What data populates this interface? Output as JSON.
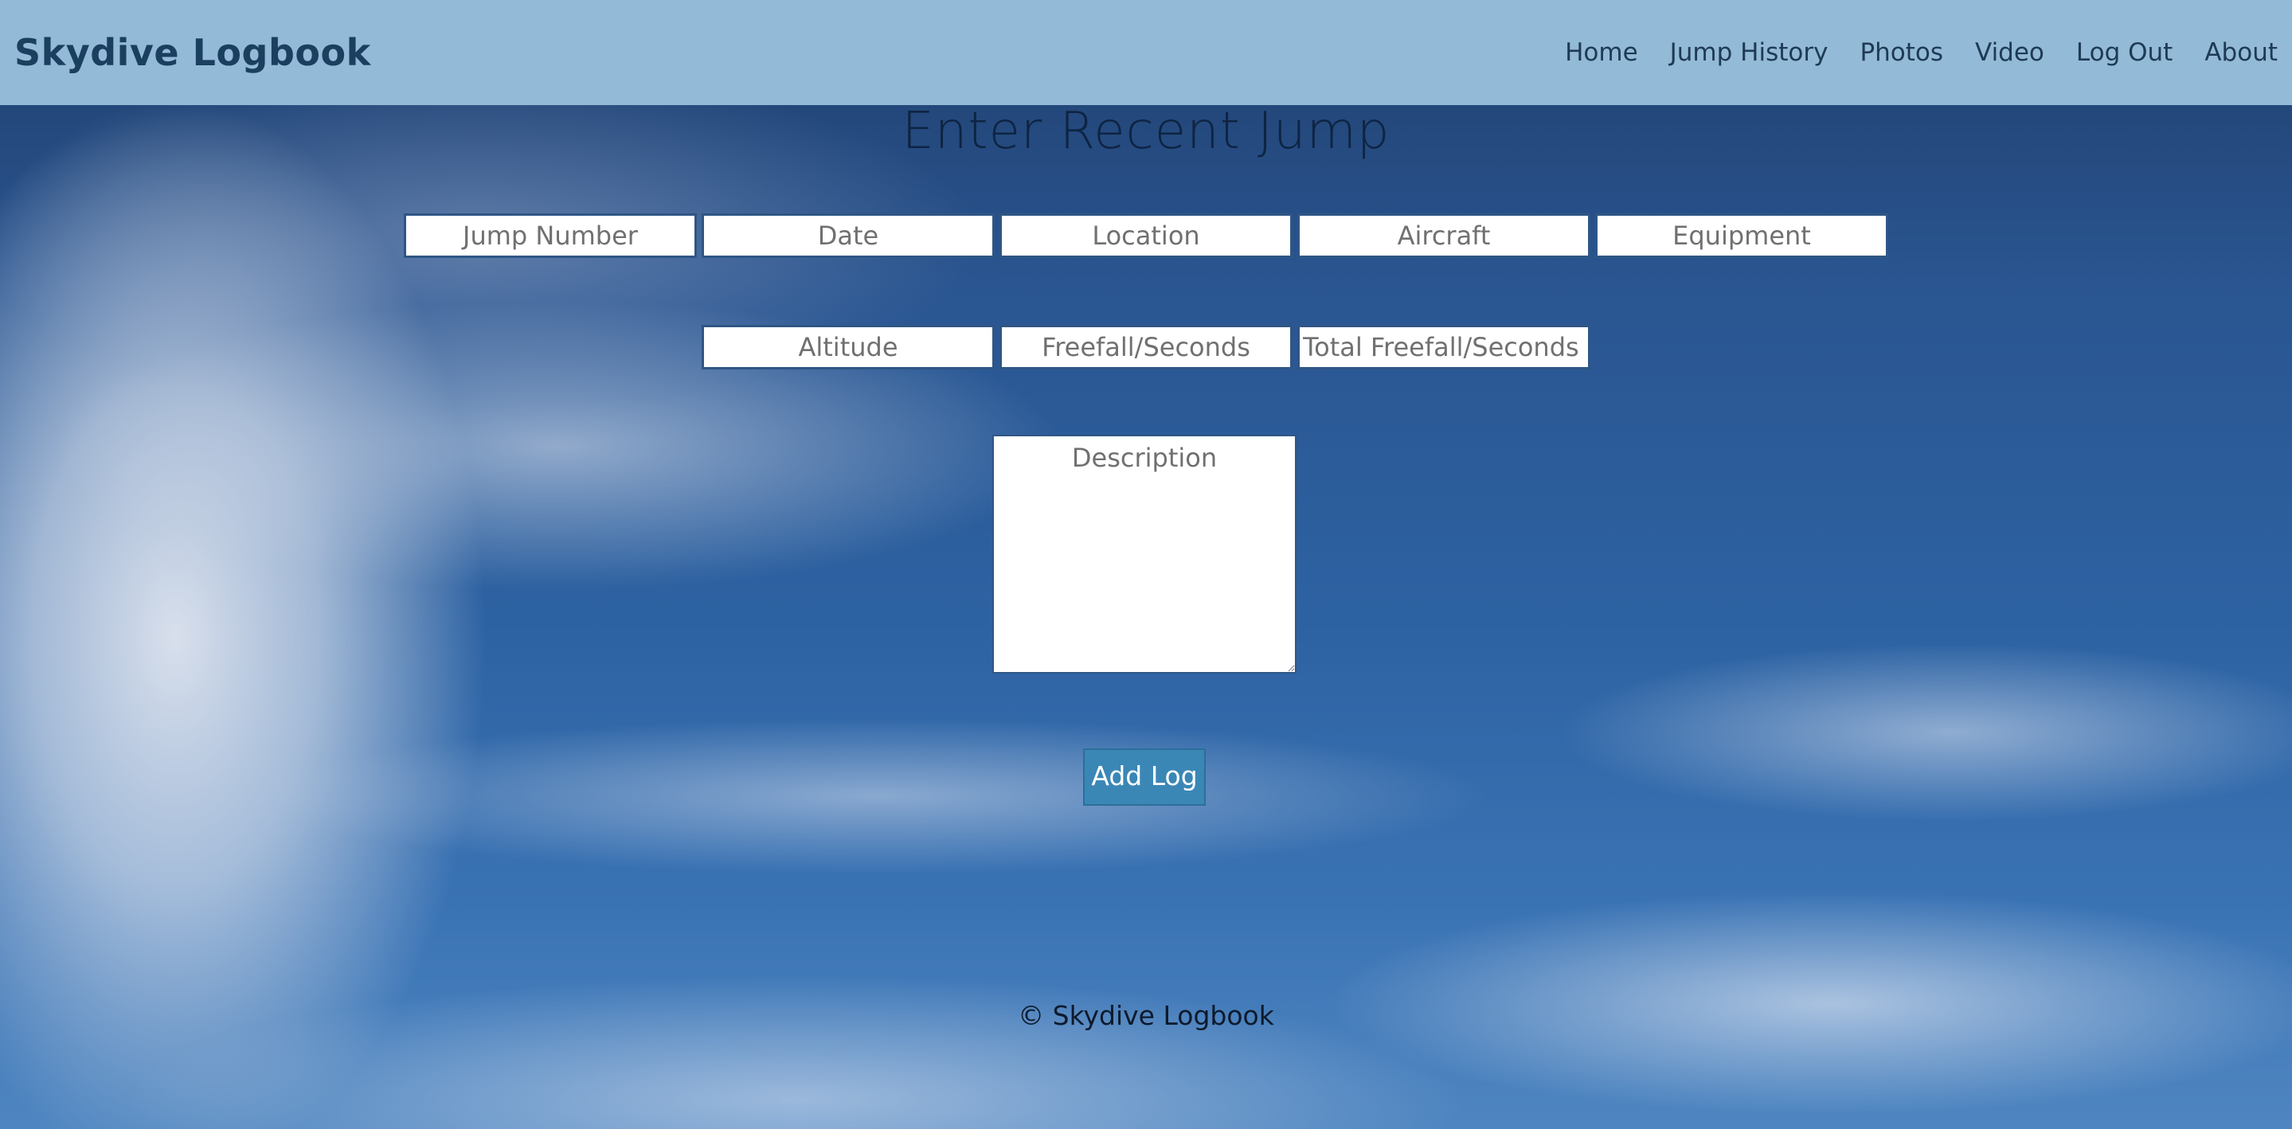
{
  "navbar": {
    "brand": "Skydive Logbook",
    "links": [
      {
        "label": "Home"
      },
      {
        "label": "Jump History"
      },
      {
        "label": "Photos"
      },
      {
        "label": "Video"
      },
      {
        "label": "Log Out"
      },
      {
        "label": "About"
      }
    ]
  },
  "form": {
    "title": "Enter Recent Jump",
    "row1": [
      {
        "placeholder": "Jump Number"
      },
      {
        "placeholder": "Date"
      },
      {
        "placeholder": "Location"
      },
      {
        "placeholder": "Aircraft"
      },
      {
        "placeholder": "Equipment"
      }
    ],
    "row2": [
      {
        "placeholder": "Altitude"
      },
      {
        "placeholder": "Freefall/Seconds"
      },
      {
        "placeholder": "Total Freefall/Seconds"
      }
    ],
    "description_placeholder": "Description",
    "submit_label": "Add Log"
  },
  "footer": {
    "text": "© Skydive Logbook"
  },
  "colors": {
    "navbar_bg": "#93bad6",
    "brand_text": "#1b3f5f",
    "button_bg": "#3a87b6",
    "field_border": "#2f5685"
  }
}
